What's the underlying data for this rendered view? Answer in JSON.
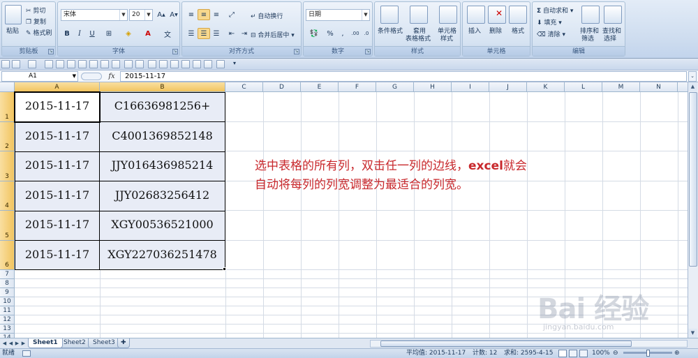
{
  "ribbon": {
    "clipboard": {
      "group": "剪贴板",
      "paste": "粘贴",
      "cut": "剪切",
      "copy": "复制",
      "format_painter": "格式刷"
    },
    "font": {
      "group": "字体",
      "font_name": "宋体",
      "font_size": "20",
      "bold": "B",
      "italic": "I",
      "underline": "U"
    },
    "alignment": {
      "group": "对齐方式",
      "wrap": "自动换行",
      "merge": "合并后居中"
    },
    "number": {
      "group": "数字",
      "format": "日期"
    },
    "styles": {
      "group": "样式",
      "conditional": "条件格式",
      "table_line1": "套用",
      "table_line2": "表格格式",
      "cell_line1": "单元格",
      "cell_line2": "样式"
    },
    "cells": {
      "group": "单元格",
      "insert": "插入",
      "delete": "删除",
      "format": "格式"
    },
    "editing": {
      "group": "编辑",
      "autosum": "自动求和",
      "fill": "填充",
      "clear": "清除",
      "sort_line1": "排序和",
      "sort_line2": "筛选",
      "find_line1": "查找和",
      "find_line2": "选择"
    }
  },
  "formula_bar": {
    "name_box": "A1",
    "fx": "fx",
    "value": "2015-11-17"
  },
  "columns": [
    "A",
    "B",
    "C",
    "D",
    "E",
    "F",
    "G",
    "H",
    "I",
    "J",
    "K",
    "L",
    "M",
    "N"
  ],
  "rows": [
    "1",
    "2",
    "3",
    "4",
    "5",
    "6",
    "7",
    "8",
    "9",
    "10",
    "11",
    "12",
    "13",
    "14"
  ],
  "cells": {
    "A": [
      "2015-11-17",
      "2015-11-17",
      "2015-11-17",
      "2015-11-17",
      "2015-11-17",
      "2015-11-17"
    ],
    "B": [
      "C16636981256+",
      "C4001369852148",
      "JJY016436985214",
      "JJY02683256412",
      "XGY00536521000",
      "XGY227036251478"
    ]
  },
  "annotation": {
    "part1": "选中表格的所有列，双击任一列的边线，",
    "bold": "excel",
    "part2": "就会",
    "line2": "自动将每列的列宽调整为最适合的列宽。",
    "color": "#c8282c"
  },
  "watermark": {
    "logo": "Bai 经验",
    "url": "jingyan.baidu.com"
  },
  "sheets": [
    "Sheet1",
    "Sheet2",
    "Sheet3"
  ],
  "status": {
    "ready": "就绪",
    "average": "平均值: 2015-11-17",
    "count": "计数: 12",
    "sum": "求和: 2595-4-15",
    "zoom": "100%"
  },
  "colors": {
    "selected_header": "#f2c45f",
    "grid_line": "#d4dbe5",
    "ribbon": "#cddcef"
  }
}
